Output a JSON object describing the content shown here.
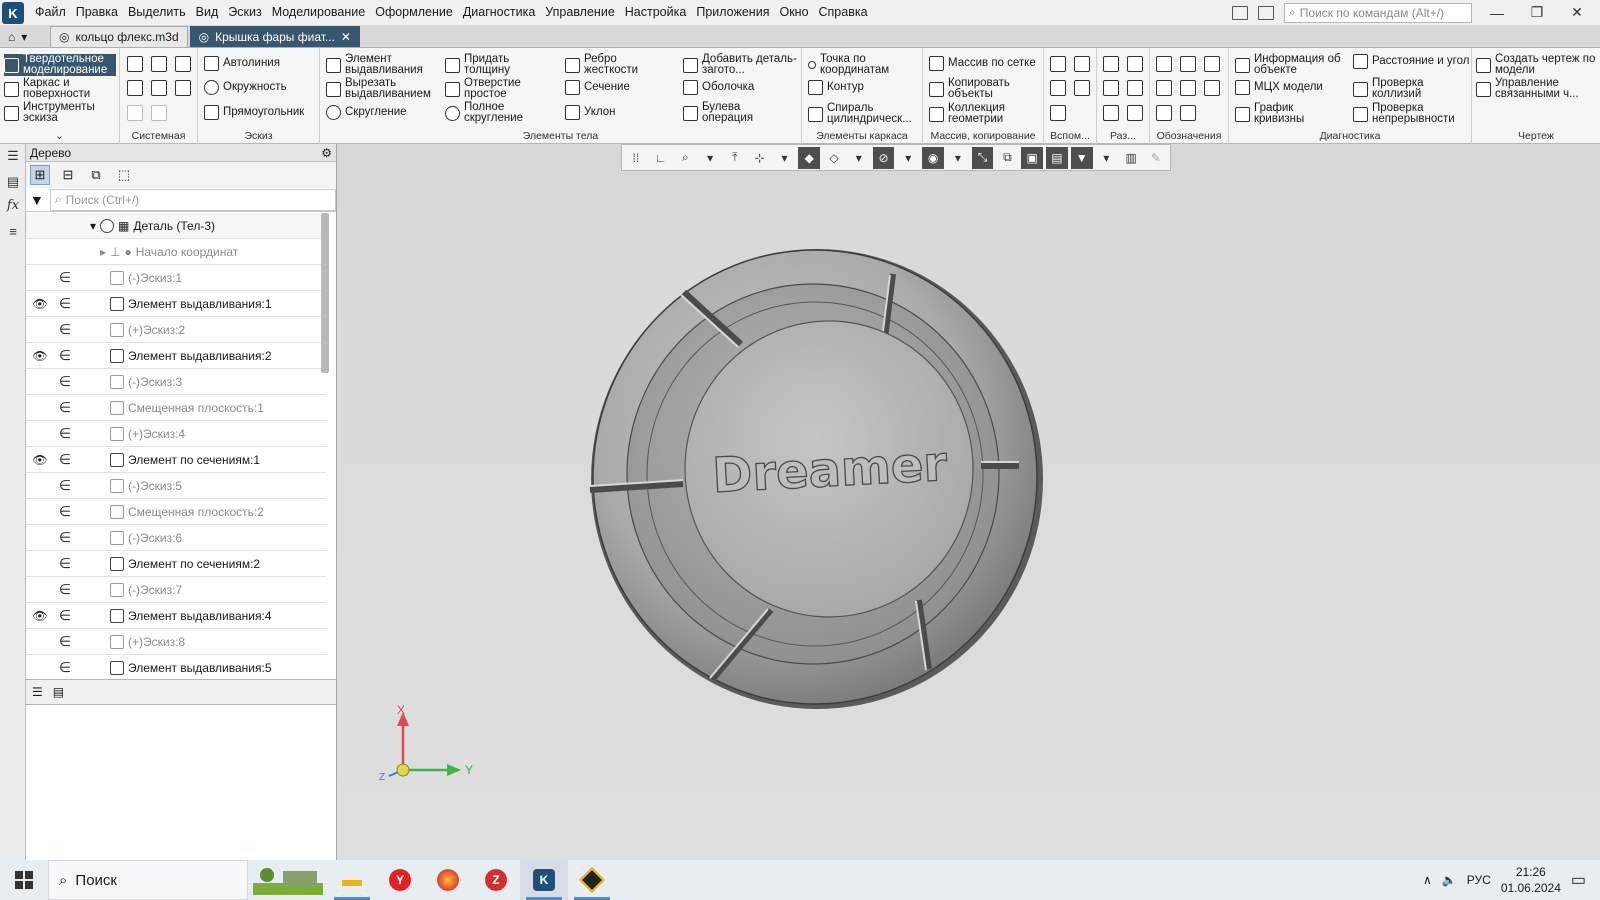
{
  "menubar": {
    "items": [
      "Файл",
      "Правка",
      "Выделить",
      "Вид",
      "Эскиз",
      "Моделирование",
      "Оформление",
      "Диагностика",
      "Управление",
      "Настройка",
      "Приложения",
      "Окно",
      "Справка"
    ],
    "command_search_placeholder": "Поиск по командам (Alt+/)"
  },
  "tabs": [
    {
      "label": "кольцо флекс.m3d"
    },
    {
      "label": "Крышка фары фиат...",
      "active": true
    }
  ],
  "ribbon": {
    "modes": [
      "Твердотельное моделирование",
      "Каркас и поверхности",
      "Инструменты эскиза"
    ],
    "groups": {
      "system": "Системная",
      "sketch": "Эскиз",
      "body": "Элементы тела",
      "frame": "Элементы каркаса",
      "array": "Массив, копирование",
      "aux": "Вспом...",
      "dim": "Раз...",
      "notation": "Обозначения",
      "diag": "Диагностика",
      "drawing": "Чертеж"
    },
    "sketch_items": [
      "Автолиния",
      "Окружность",
      "Прямоугольник"
    ],
    "body_items": [
      "Элемент выдавливания",
      "Вырезать выдавливанием",
      "Скругление",
      "Придать толщину",
      "Отверстие простое",
      "Полное скругление",
      "Ребро жесткости",
      "Сечение",
      "Уклон",
      "Добавить деталь-загото...",
      "Оболочка",
      "Булева операция"
    ],
    "frame_items": [
      "Точка по координатам",
      "Контур",
      "Спираль цилиндрическ..."
    ],
    "array_items": [
      "Массив по сетке",
      "Копировать объекты",
      "Коллекция геометрии"
    ],
    "diag_items": [
      "Информация об объекте",
      "МЦХ модели",
      "График кривизны",
      "Расстояние и угол",
      "Проверка коллизий",
      "Проверка непрерывности"
    ],
    "drawing_items": [
      "Создать чертеж по модели",
      "Управление связанными ч..."
    ]
  },
  "tree": {
    "title": "Дерево",
    "search_placeholder": "Поиск (Ctrl+/)",
    "root": "Деталь (Тел-3)",
    "origin": "Начало координат",
    "rows": [
      {
        "label": "(-)Эскиз:1",
        "visible": false,
        "dim": true
      },
      {
        "label": "Элемент выдавливания:1",
        "visible": true,
        "dim": false
      },
      {
        "label": "(+)Эскиз:2",
        "visible": false,
        "dim": true
      },
      {
        "label": "Элемент выдавливания:2",
        "visible": true,
        "dim": false
      },
      {
        "label": "(-)Эскиз:3",
        "visible": false,
        "dim": true
      },
      {
        "label": "Смещенная плоскость:1",
        "visible": false,
        "dim": true
      },
      {
        "label": "(+)Эскиз:4",
        "visible": false,
        "dim": true
      },
      {
        "label": "Элемент по сечениям:1",
        "visible": true,
        "dim": false
      },
      {
        "label": "(-)Эскиз:5",
        "visible": false,
        "dim": true
      },
      {
        "label": "Смещенная плоскость:2",
        "visible": false,
        "dim": true
      },
      {
        "label": "(-)Эскиз:6",
        "visible": false,
        "dim": true
      },
      {
        "label": "Элемент по сечениям:2",
        "visible": false,
        "dim": false
      },
      {
        "label": "(-)Эскиз:7",
        "visible": false,
        "dim": true
      },
      {
        "label": "Элемент выдавливания:4",
        "visible": true,
        "dim": false
      },
      {
        "label": "(+)Эскиз:8",
        "visible": false,
        "dim": true
      },
      {
        "label": "Элемент выдавливания:5",
        "visible": false,
        "dim": false
      }
    ]
  },
  "model": {
    "embossed_text": "Dreamer"
  },
  "triad": {
    "x": "X",
    "y": "Y",
    "z": "Z"
  },
  "taskbar": {
    "search_label": "Поиск",
    "language": "РУС",
    "time": "21:26",
    "date": "01.06.2024"
  },
  "colors": {
    "accent": "#39566f",
    "viewport": "#d9d9d9"
  }
}
